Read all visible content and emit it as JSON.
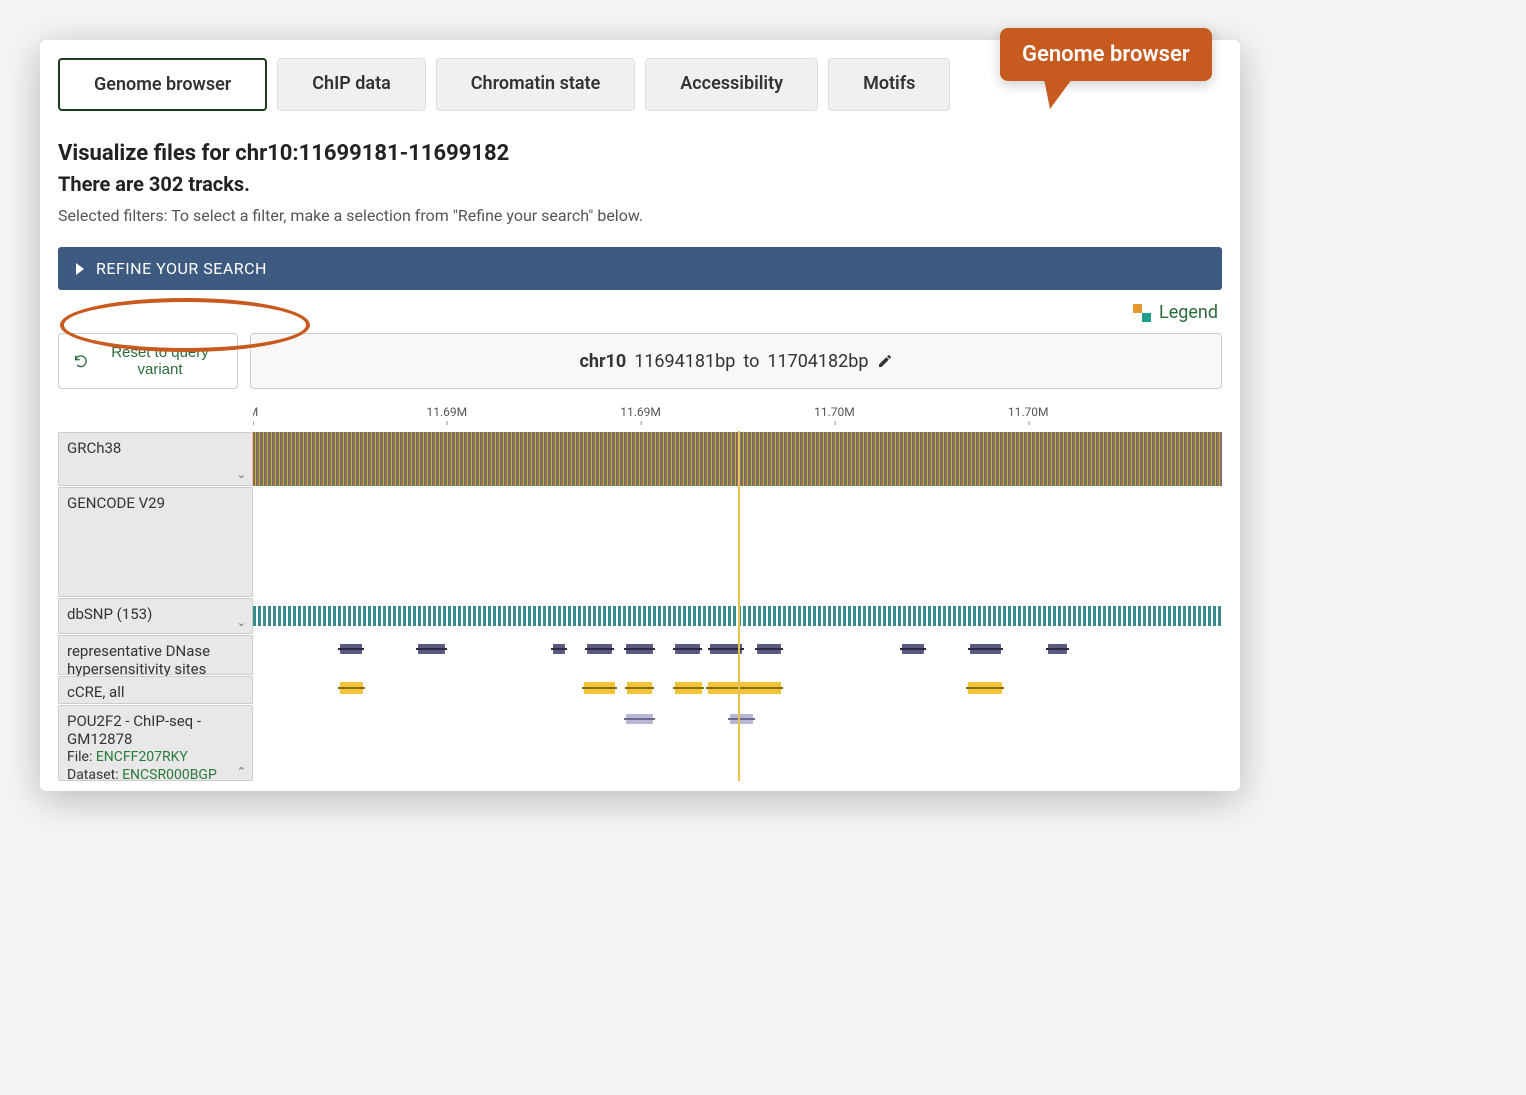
{
  "callout": {
    "label": "Genome browser"
  },
  "tabs": [
    {
      "label": "Genome browser",
      "active": true
    },
    {
      "label": "ChIP data",
      "active": false
    },
    {
      "label": "Chromatin state",
      "active": false
    },
    {
      "label": "Accessibility",
      "active": false
    },
    {
      "label": "Motifs",
      "active": false
    }
  ],
  "heading": "Visualize files for chr10:11699181-11699182",
  "subheading": "There are 302 tracks.",
  "filters_hint": "Selected filters: To select a filter, make a selection from \"Refine your search\" below.",
  "refine_label": "REFINE YOUR SEARCH",
  "legend_label": "Legend",
  "reset_label": "Reset to query variant",
  "range": {
    "chrom": "chr10",
    "start": "11694181bp",
    "end": "11704182bp",
    "joiner": " to "
  },
  "ruler_ticks": [
    "M",
    "11.69M",
    "11.69M",
    "11.70M",
    "11.70M"
  ],
  "tracks": {
    "grch38": {
      "label": "GRCh38"
    },
    "gencode": {
      "label": "GENCODE V29"
    },
    "dbsnp": {
      "label": "dbSNP (153)"
    },
    "dnase": {
      "label": "representative DNase hypersensitivity sites",
      "blocks_pct": [
        {
          "l": 9,
          "w": 2.2
        },
        {
          "l": 17,
          "w": 2.8
        },
        {
          "l": 31,
          "w": 1.2
        },
        {
          "l": 34.5,
          "w": 2.5
        },
        {
          "l": 38.5,
          "w": 2.8
        },
        {
          "l": 43.5,
          "w": 2.6
        },
        {
          "l": 47.2,
          "w": 3.3
        },
        {
          "l": 52,
          "w": 2.5
        },
        {
          "l": 67,
          "w": 2.2
        },
        {
          "l": 74,
          "w": 3.2
        },
        {
          "l": 82,
          "w": 2.0
        }
      ]
    },
    "ccre": {
      "label": "cCRE, all",
      "blocks_pct": [
        {
          "l": 9,
          "w": 2.4
        },
        {
          "l": 34.2,
          "w": 3.2
        },
        {
          "l": 38.6,
          "w": 2.6
        },
        {
          "l": 43.5,
          "w": 2.8
        },
        {
          "l": 47,
          "w": 7.5
        },
        {
          "l": 73.8,
          "w": 3.5
        }
      ]
    },
    "chipseq": {
      "label": "POU2F2 - ChIP-seq - GM12878",
      "file_prefix": "File: ",
      "file_id": "ENCFF207RKY",
      "dataset_prefix": "Dataset: ",
      "dataset_id": "ENCSR000BGP",
      "blocks_pct": [
        {
          "l": 38.5,
          "w": 2.8
        },
        {
          "l": 49.2,
          "w": 2.4
        }
      ]
    }
  },
  "annotations": {
    "refine_ellipse": true,
    "dataset_ellipse": true
  }
}
